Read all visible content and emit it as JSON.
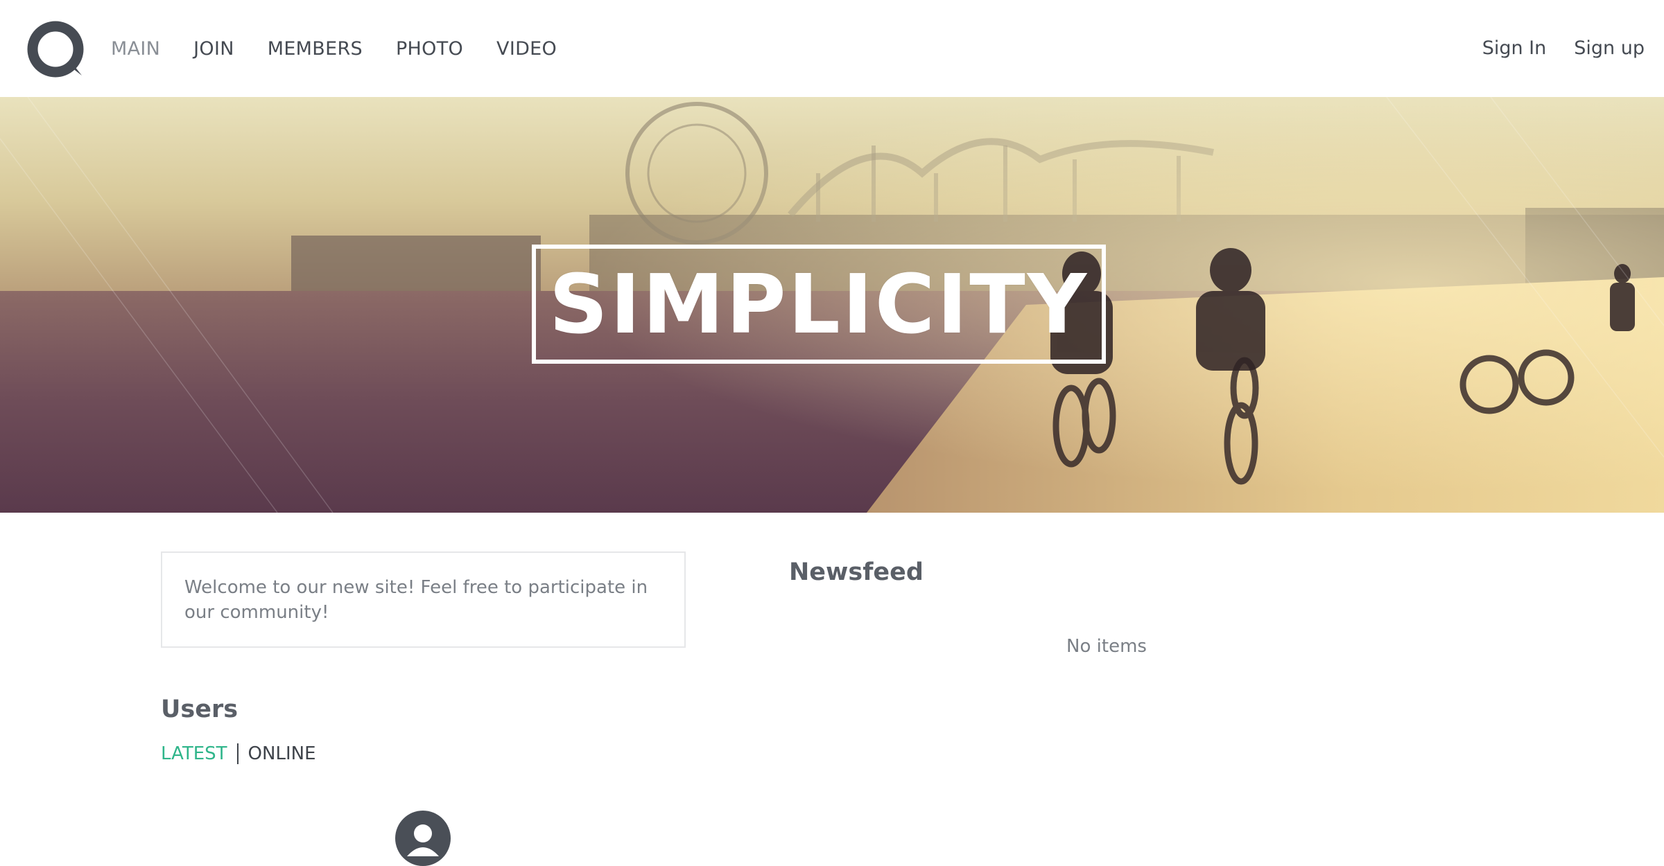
{
  "header": {
    "logo_icon": "ring-logo-icon",
    "nav": [
      {
        "label": "MAIN",
        "active": true
      },
      {
        "label": "JOIN",
        "active": false
      },
      {
        "label": "MEMBERS",
        "active": false
      },
      {
        "label": "PHOTO",
        "active": false
      },
      {
        "label": "VIDEO",
        "active": false
      }
    ],
    "sign_in": "Sign In",
    "sign_up": "Sign up"
  },
  "hero": {
    "title": "SIMPLICITY",
    "image": "beach-pier-bicycles-photo"
  },
  "welcome": {
    "text": "Welcome to our new site! Feel free to participate in our community!"
  },
  "newsfeed": {
    "title": "Newsfeed",
    "empty_text": "No items"
  },
  "users": {
    "title": "Users",
    "tabs": [
      {
        "label": "LATEST",
        "active": true
      },
      {
        "label": "ONLINE",
        "active": false
      }
    ],
    "avatar_icon": "user-avatar-icon"
  },
  "colors": {
    "accent": "#2fb58a",
    "text_dark": "#454a52",
    "text_muted": "#7a7f86",
    "logo": "#464b53"
  }
}
